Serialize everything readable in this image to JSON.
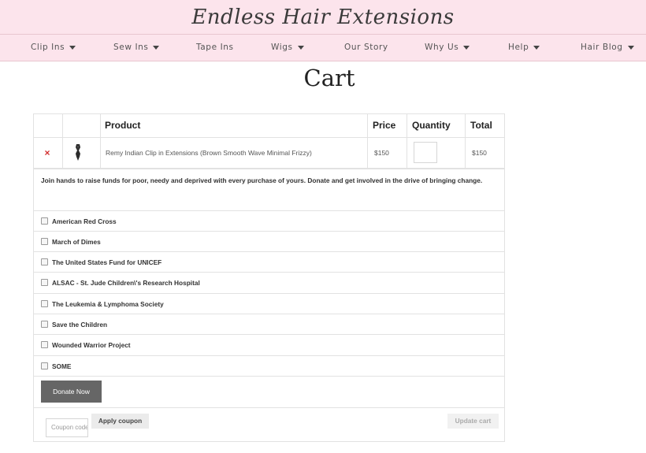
{
  "brand": {
    "name": "Endless Hair Extensions"
  },
  "nav": {
    "clip_ins": "Clip Ins",
    "sew_ins": "Sew Ins",
    "tape_ins": "Tape Ins",
    "wigs": "Wigs",
    "our_story": "Our Story",
    "why_us": "Why Us",
    "help": "Help",
    "hair_blog": "Hair Blog"
  },
  "page": {
    "title": "Cart"
  },
  "cart": {
    "headers": {
      "product": "Product",
      "price": "Price",
      "quantity": "Quantity",
      "total": "Total"
    },
    "items": [
      {
        "remove": "×",
        "name": "Remy Indian Clip in Extensions (Brown Smooth Wave Minimal Frizzy)",
        "price": "$150",
        "quantity": "",
        "total": "$150"
      }
    ]
  },
  "donation": {
    "message": "Join hands to raise funds for poor, needy and deprived with every purchase of yours. Donate and get involved in the drive of bringing change.",
    "options": [
      "American Red Cross",
      "March of Dimes",
      "The United States Fund for UNICEF",
      "ALSAC - St. Jude Children\\'s Research Hospital",
      "The Leukemia & Lymphoma Society",
      "Save the Children",
      "Wounded Warrior Project",
      "SOME"
    ],
    "button": "Donate Now"
  },
  "actions": {
    "coupon_placeholder": "Coupon code",
    "apply_label": "Apply coupon",
    "update_label": "Update cart"
  },
  "colors": {
    "header_bg": "#fce4ec",
    "remove_red": "#d32f2f",
    "donate_button": "#666666"
  }
}
